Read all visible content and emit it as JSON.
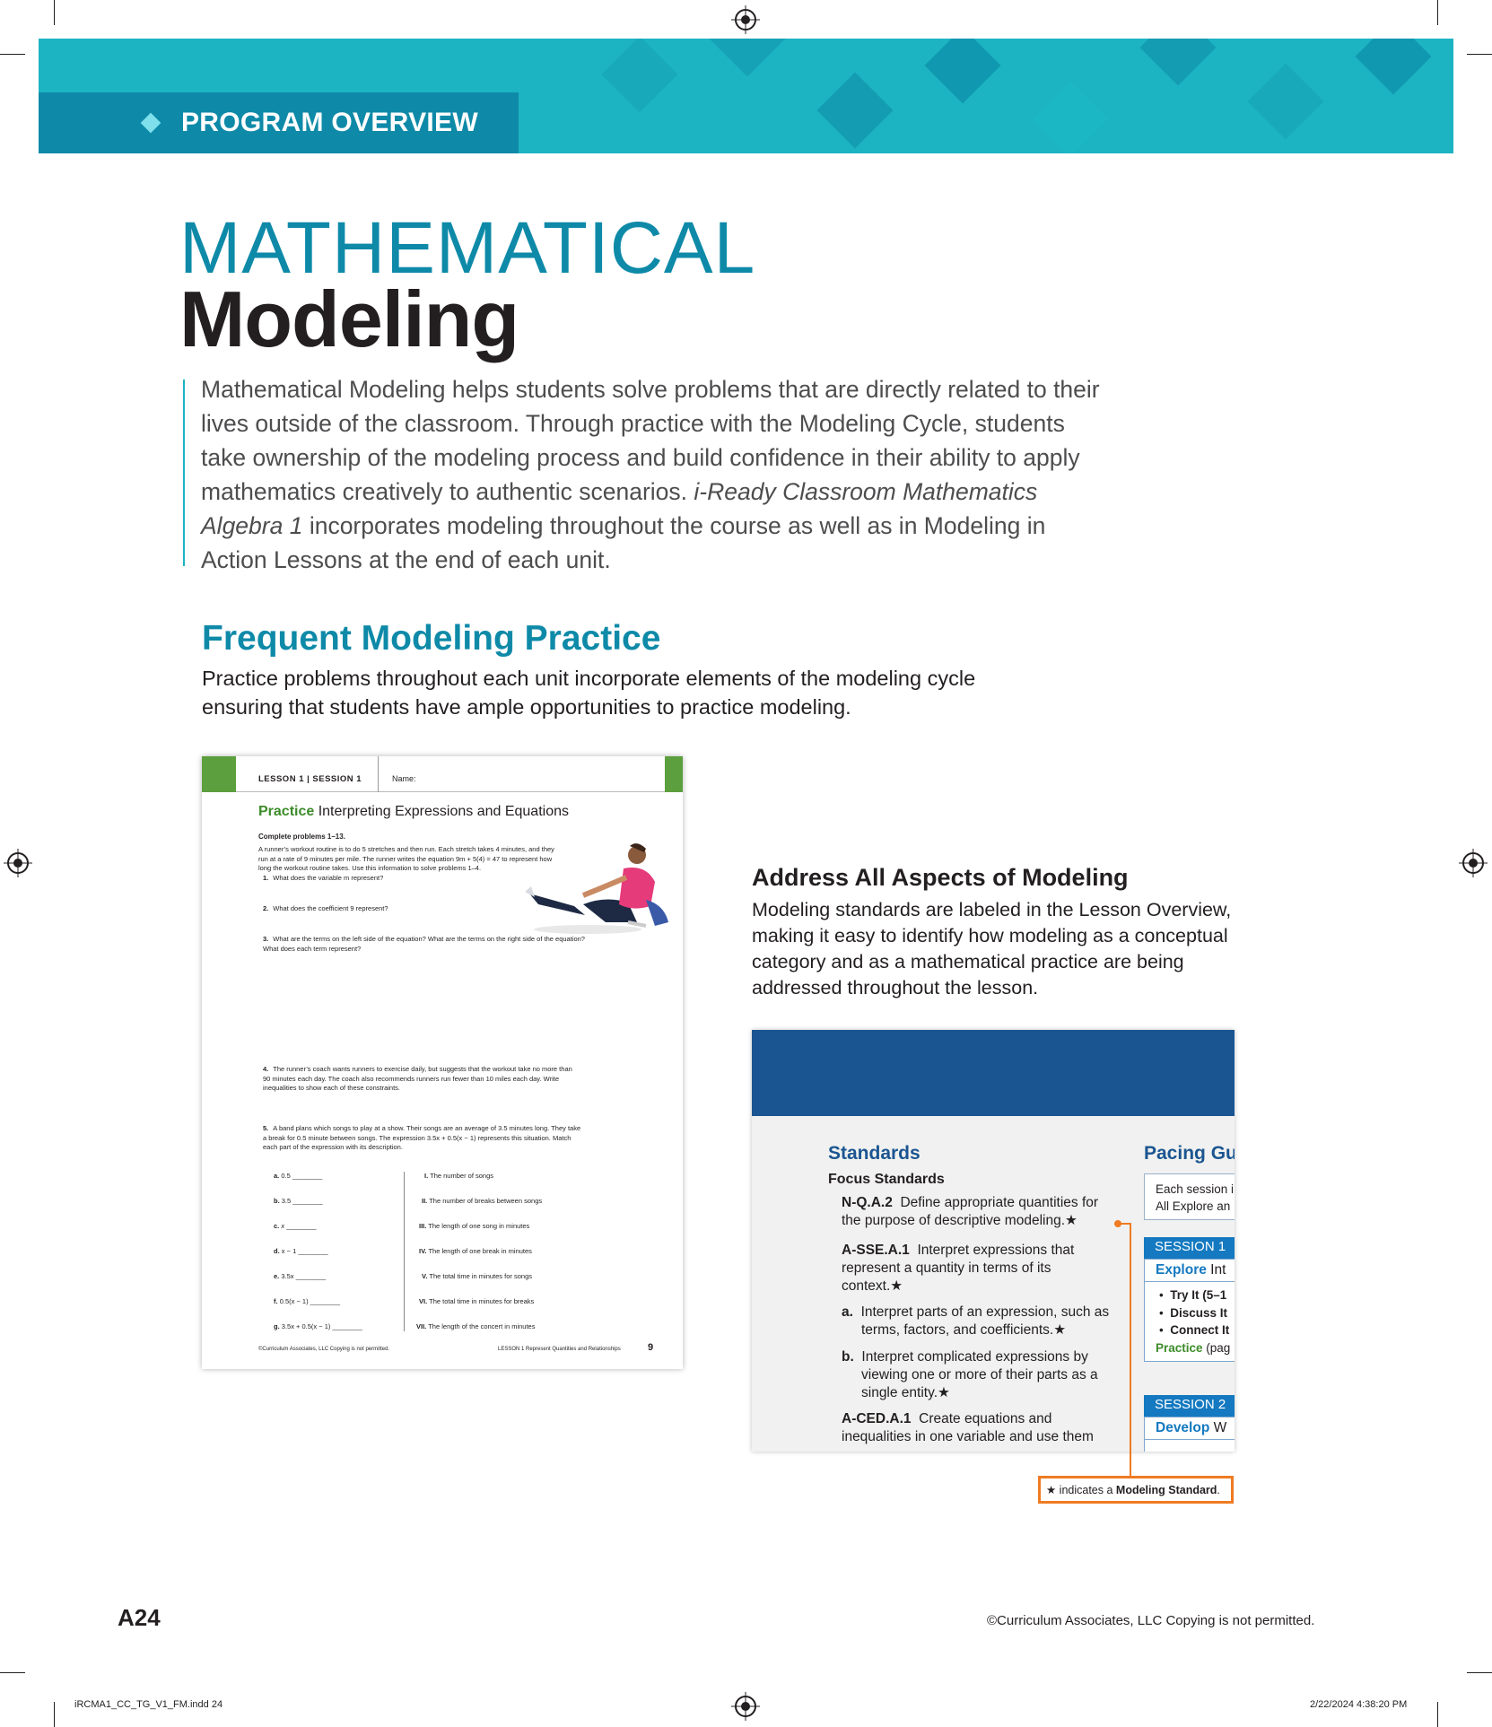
{
  "banner": {
    "label": "PROGRAM OVERVIEW",
    "accent": "#1cb3c2",
    "tab_color": "#0e8aa8"
  },
  "title": {
    "line1": "MATHEMATICAL",
    "line2": "Modeling"
  },
  "intro": {
    "part1": "Mathematical Modeling helps students solve problems that are directly related to their lives outside of the classroom. Through practice with the Modeling Cycle, students take ownership of the modeling process and build confidence in their ability to apply mathematics creatively to authentic scenarios. ",
    "italic": "i-Ready Classroom Mathematics Algebra 1",
    "part2": " incorporates modeling throughout the course as well as in Modeling in Action Lessons at the end of each unit."
  },
  "frequent": {
    "title": "Frequent Modeling Practice",
    "body": "Practice problems throughout each unit incorporate elements of the modeling cycle ensuring that students have ample opportunities to practice modeling."
  },
  "worksheet": {
    "lesson_label": "LESSON 1  |  SESSION 1",
    "name_label": "Name:",
    "title_bold": "Practice",
    "title_rest": " Interpreting Expressions and Equations",
    "complete": "Complete problems 1–13.",
    "scenario": "A runner’s workout routine is to do 5 stretches and then run. Each stretch takes 4 minutes, and they run at a rate of 9 minutes per mile. The runner writes the equation 9m + 5(4) = 47 to represent how long the workout routine takes. Use this information to solve problems 1–4.",
    "questions": [
      {
        "num": "1.",
        "text": "What does the variable m represent?"
      },
      {
        "num": "2.",
        "text": "What does the coefficient 9 represent?"
      },
      {
        "num": "3.",
        "text": "What are the terms on the left side of the equation? What are the terms on the right side of the equation? What does each term represent?"
      },
      {
        "num": "4.",
        "text": "The runner’s coach wants runners to exercise daily, but suggests that the workout take no more than 90 minutes each day. The coach also recommends runners run fewer than 10 miles each day. Write inequalities to show each of these constraints."
      },
      {
        "num": "5.",
        "text": "A band plans which songs to play at a show. Their songs are an average of 3.5 minutes long. They take a break for 0.5 minute between songs. The expression 3.5x + 0.5(x − 1) represents this situation. Match each part of the expression with its description."
      }
    ],
    "match_left": [
      {
        "letter": "a.",
        "expr": "0.5"
      },
      {
        "letter": "b.",
        "expr": "3.5"
      },
      {
        "letter": "c.",
        "expr": "x"
      },
      {
        "letter": "d.",
        "expr": "x − 1"
      },
      {
        "letter": "e.",
        "expr": "3.5x"
      },
      {
        "letter": "f.",
        "expr": "0.5(x − 1)"
      },
      {
        "letter": "g.",
        "expr": "3.5x + 0.5(x − 1)"
      }
    ],
    "match_right": [
      {
        "num": "I.",
        "text": "The number of songs"
      },
      {
        "num": "II.",
        "text": "The number of breaks between songs"
      },
      {
        "num": "III.",
        "text": "The length of one song in minutes"
      },
      {
        "num": "IV.",
        "text": "The length of one break in minutes"
      },
      {
        "num": "V.",
        "text": "The total time in minutes for songs"
      },
      {
        "num": "VI.",
        "text": "The total time in minutes for breaks"
      },
      {
        "num": "VII.",
        "text": "The length of the concert in minutes"
      }
    ],
    "footer_left": "©Curriculum Associates, LLC    Copying is not permitted.",
    "footer_right": "LESSON 1  Represent Quantities and Relationships",
    "page": "9"
  },
  "address": {
    "title": "Address All Aspects of Modeling",
    "body": "Modeling standards are labeled in the Lesson Overview, making it easy to identify how modeling as a conceptual category and as a mathematical practice are being addressed throughout the lesson."
  },
  "lesson_overview": {
    "standards_title": "Standards",
    "focus_title": "Focus Standards",
    "items": [
      {
        "code": "N-Q.A.2",
        "text": "Define appropriate quantities for the purpose of descriptive modeling.★"
      },
      {
        "code": "A-SSE.A.1",
        "text": "Interpret expressions that represent a quantity in terms of its context.★"
      },
      {
        "code": "a.",
        "text": "Interpret parts of an expression, such as terms, factors, and coefficients.★"
      },
      {
        "code": "b.",
        "text": "Interpret complicated expressions by viewing one or more of their parts as a single entity.★"
      },
      {
        "code": "A-CED.A.1",
        "text": "Create equations and inequalities in one variable and use them"
      }
    ],
    "pacing_title": "Pacing Gu",
    "each_session": "Each session i",
    "all_explore": "All Explore an",
    "session1": "SESSION 1",
    "s1_head_bold": "Explore",
    "s1_head_rest": " Int",
    "s1_items": [
      "Try It  (5–1",
      "Discuss It",
      "Connect It"
    ],
    "s1_practice_bold": "Practice",
    "s1_practice_rest": " (pag",
    "session2": "SESSION 2",
    "s2_head_bold": "Develop",
    "s2_head_rest": " W"
  },
  "key": {
    "prefix": "★ indicates a ",
    "bold": "Modeling Standard",
    "suffix": "."
  },
  "page_number": "A24",
  "copyright": "©Curriculum Associates, LLC    Copying is not permitted.",
  "slug_left": "iRCMA1_CC_TG_V1_FM.indd   24",
  "slug_right": "2/22/2024   4:38:20 PM"
}
